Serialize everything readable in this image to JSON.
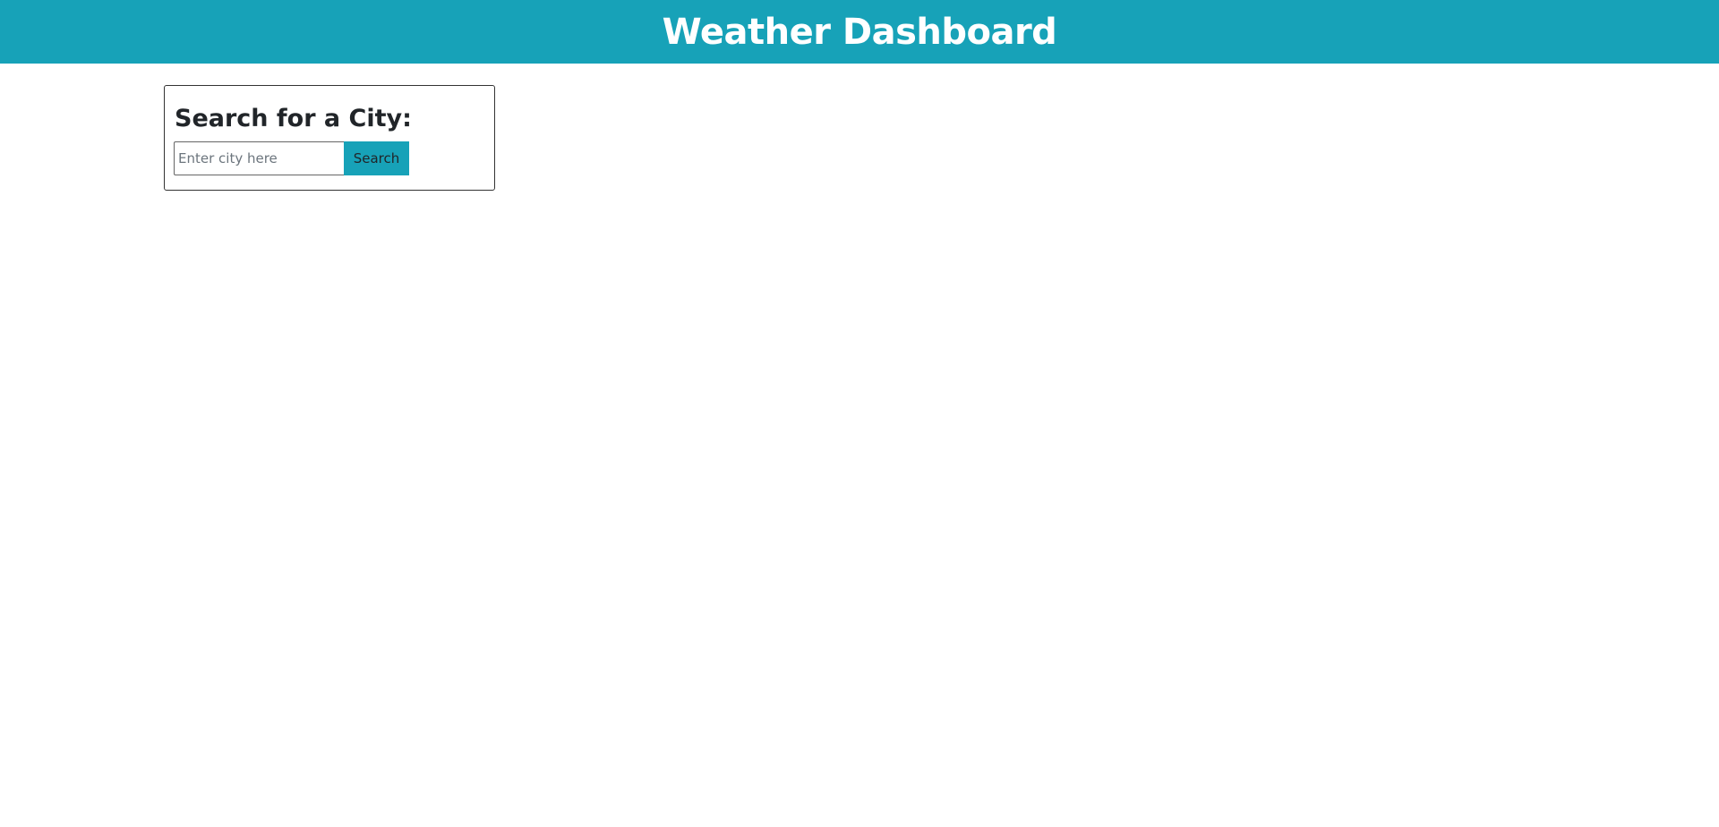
{
  "header": {
    "title": "Weather Dashboard"
  },
  "search": {
    "heading": "Search for a City:",
    "input_value": "",
    "placeholder": "Enter city here",
    "button_label": "Search"
  },
  "colors": {
    "accent": "#17a2b8",
    "header_text": "#ffffff",
    "body_text": "#212529"
  }
}
